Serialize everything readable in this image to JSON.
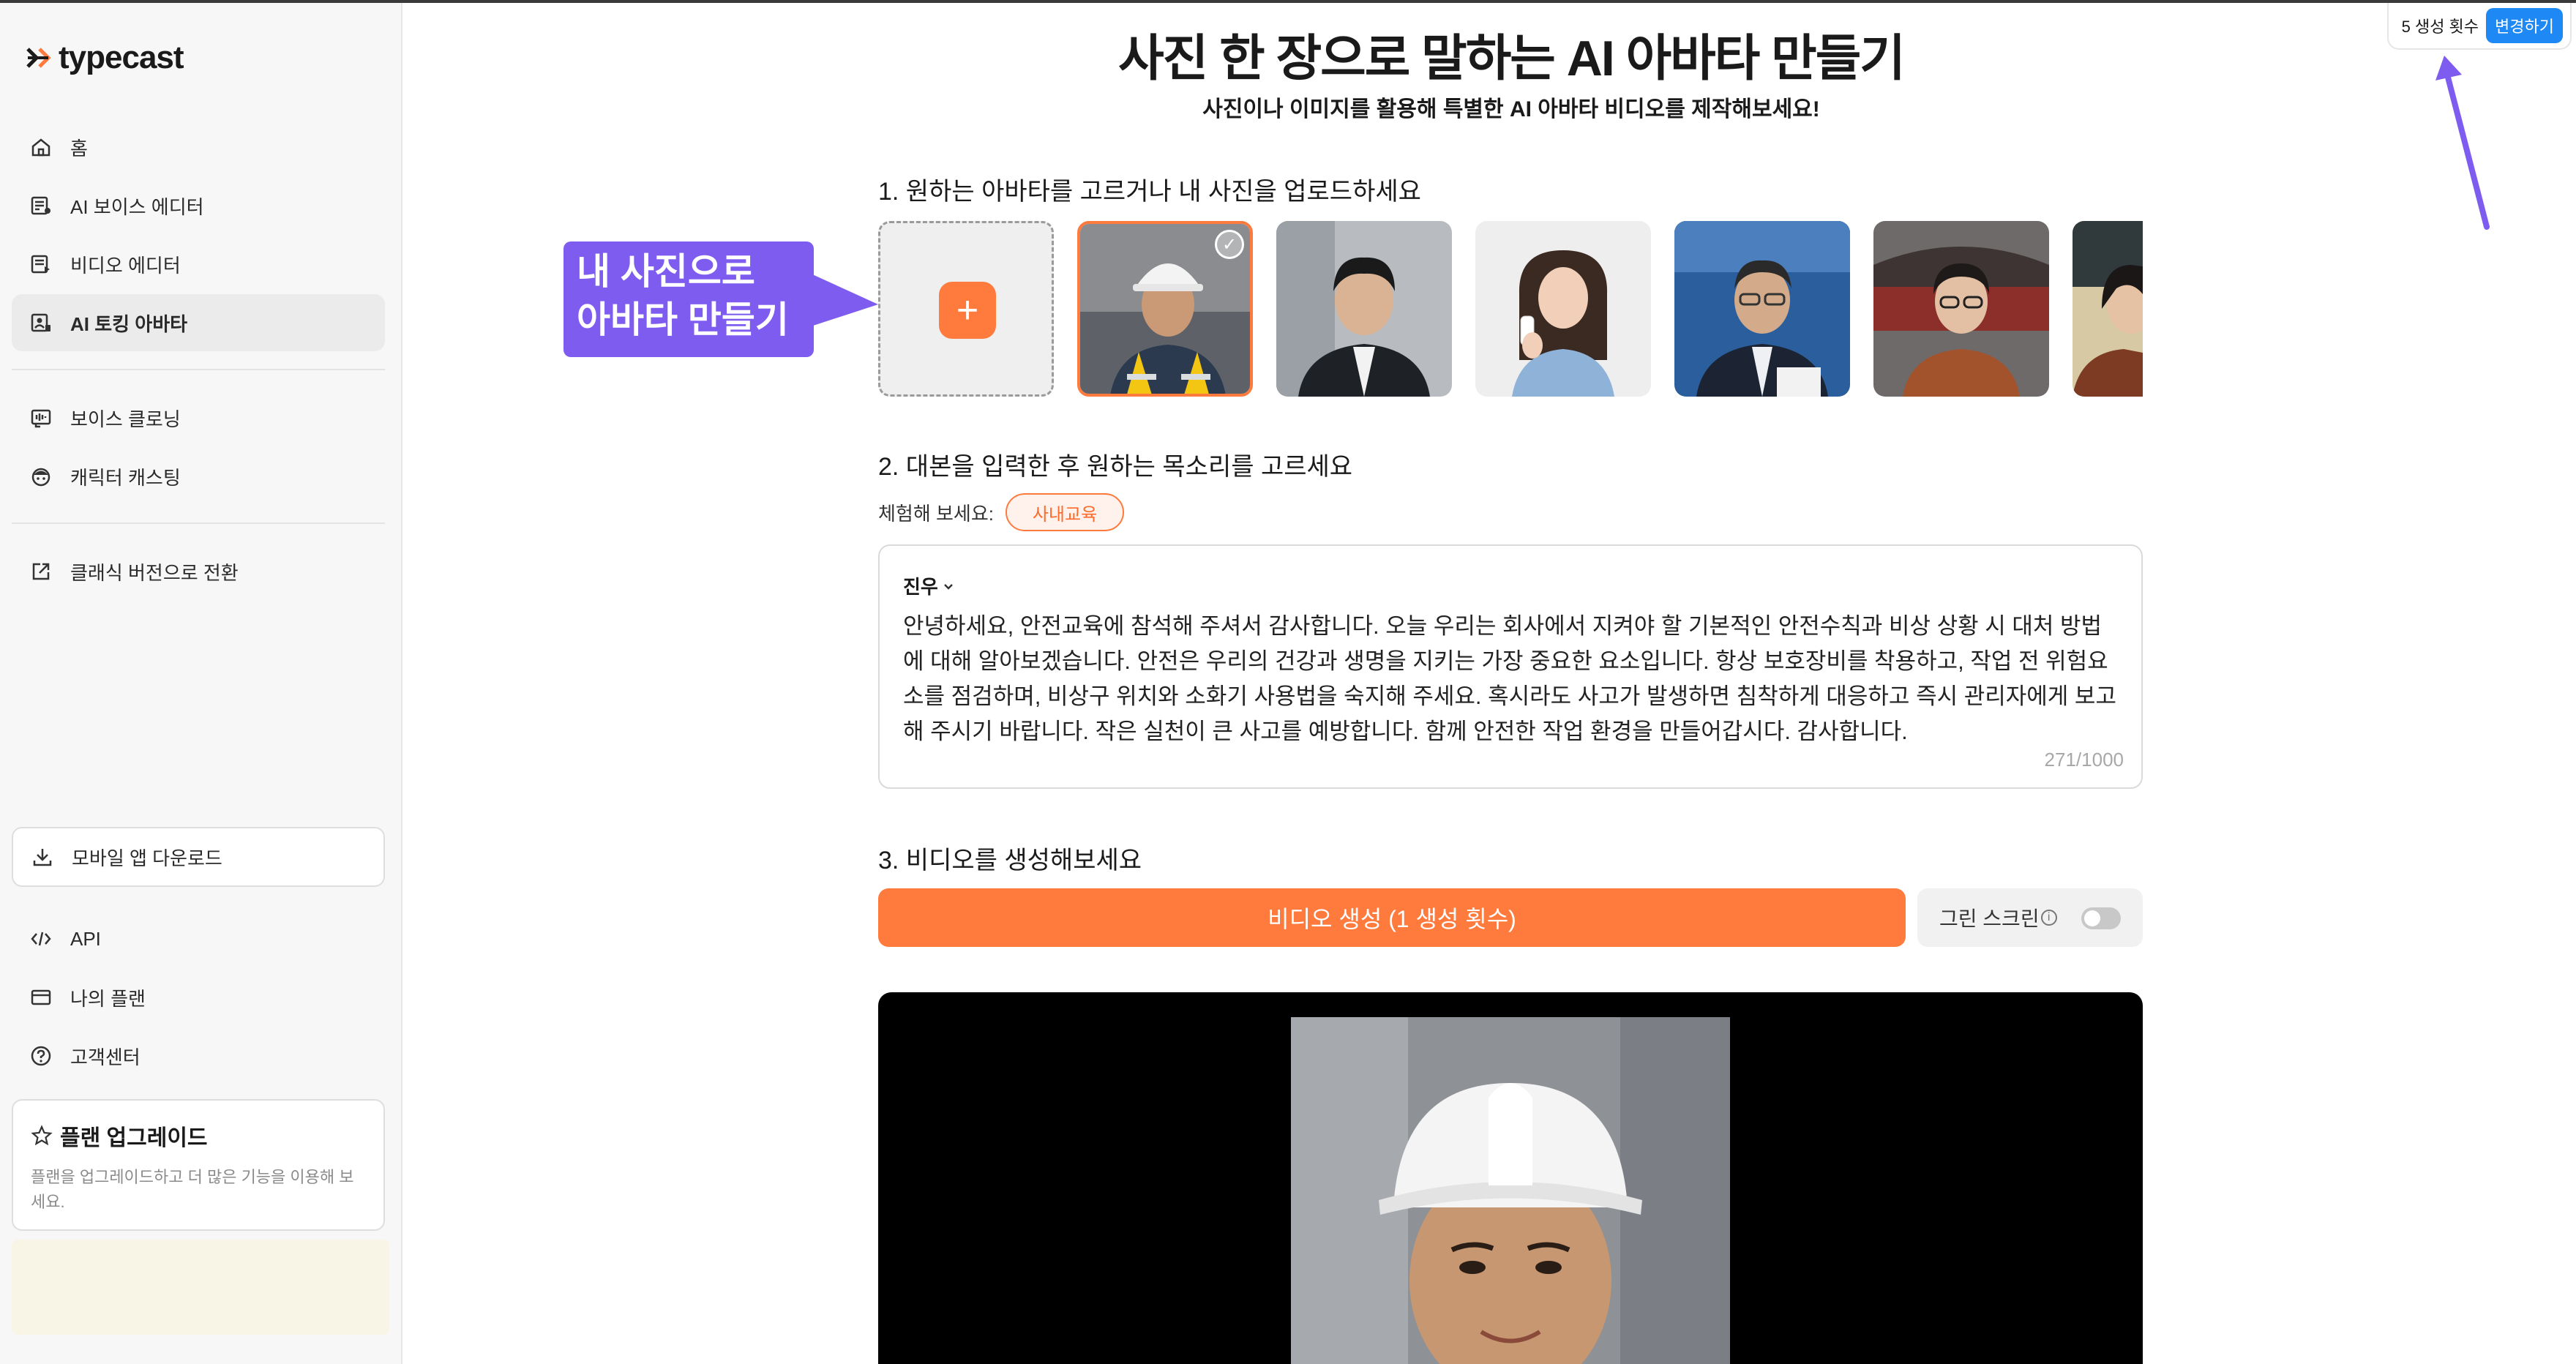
{
  "app": {
    "logo_text": "typecast"
  },
  "sidebar": {
    "items": [
      {
        "label": "홈",
        "icon": "home-icon"
      },
      {
        "label": "AI 보이스 에디터",
        "icon": "voice-editor-icon"
      },
      {
        "label": "비디오 에디터",
        "icon": "video-editor-icon"
      },
      {
        "label": "AI 토킹 아바타",
        "icon": "talking-avatar-icon",
        "active": true
      },
      {
        "label": "보이스 클로닝",
        "icon": "voice-cloning-icon"
      },
      {
        "label": "캐릭터 캐스팅",
        "icon": "character-icon"
      },
      {
        "label": "클래식 버전으로 전환",
        "icon": "external-link-icon"
      }
    ],
    "download_label": "모바일 앱 다운로드",
    "bottom_items": [
      {
        "label": "API",
        "icon": "code-icon"
      },
      {
        "label": "나의 플랜",
        "icon": "card-icon"
      },
      {
        "label": "고객센터",
        "icon": "help-icon"
      }
    ],
    "upgrade": {
      "title": "플랜 업그레이드",
      "description": "플랜을 업그레이드하고 더 많은 기능을 이용해 보세요."
    }
  },
  "credits": {
    "label": "5 생성 횟수",
    "change_button": "변경하기"
  },
  "main": {
    "title": "사진 한 장으로 말하는 AI 아바타 만들기",
    "subtitle": "사진이나 이미지를 활용해 특별한 AI 아바타 비디오를 제작해보세요!",
    "step1": "1. 원하는 아바타를 고르거나 내 사진을 업로드하세요",
    "step2": "2. 대본을 입력한 후 원하는 목소리를 고르세요",
    "step3": "3. 비디오를 생성해보세요",
    "callout": {
      "line1": "내 사진으로",
      "line2": "아바타 만들기"
    },
    "try_label": "체험해 보세요:",
    "chip": "사내교육",
    "speaker": "진우",
    "script": "안녕하세요, 안전교육에 참석해 주셔서 감사합니다. 오늘 우리는 회사에서 지켜야 할 기본적인 안전수칙과 비상 상황 시 대처 방법에 대해 알아보겠습니다. 안전은 우리의 건강과 생명을 지키는 가장 중요한 요소입니다. 항상 보호장비를 착용하고, 작업 전 위험요소를 점검하며, 비상구 위치와 소화기 사용법을 숙지해 주세요. 혹시라도 사고가 발생하면 침착하게 대응하고 즉시 관리자에게 보고해 주시기 바랍니다. 작은 실천이 큰 사고를 예방합니다. 함께 안전한 작업 환경을 만들어갑시다. 감사합니다.",
    "char_count": "271/1000",
    "generate_button": "비디오 생성 (1 생성 횟수)",
    "green_screen_label": "그린 스크린",
    "green_screen_on": false
  },
  "colors": {
    "accent": "#ff7a3d",
    "callout": "#7e5cf0",
    "change_button": "#1e88f5"
  }
}
